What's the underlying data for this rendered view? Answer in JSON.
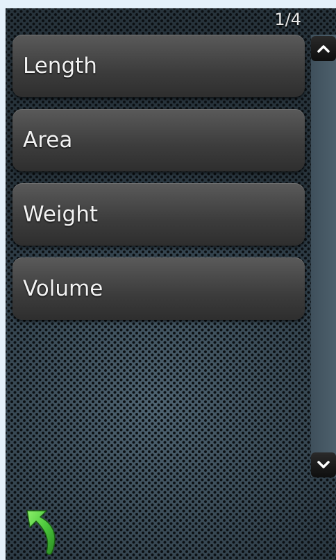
{
  "page_indicator": "1/4",
  "menu": {
    "items": [
      {
        "label": "Length"
      },
      {
        "label": "Area"
      },
      {
        "label": "Weight"
      },
      {
        "label": "Volume"
      }
    ]
  },
  "icons": {
    "scroll_up": "chevron-up-icon",
    "scroll_down": "chevron-down-icon",
    "back": "back-arrow-icon"
  },
  "colors": {
    "item_text": "#f2f2f2",
    "back_arrow": "#4cc83c"
  }
}
